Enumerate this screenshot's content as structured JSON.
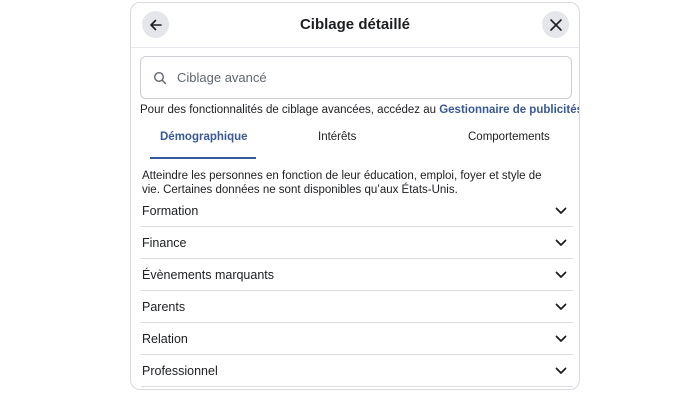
{
  "dialog": {
    "title": "Ciblage détaillé",
    "back_icon": "arrow-left-icon",
    "close_icon": "close-icon"
  },
  "search": {
    "placeholder": "Ciblage avancé",
    "value": "",
    "icon": "search-icon"
  },
  "hint": {
    "text": "Pour des fonctionnalités de ciblage avancées, accédez au ",
    "link": "Gestionnaire de publicités",
    "suffix": "."
  },
  "tabs": [
    {
      "label": "Démographique",
      "active": true
    },
    {
      "label": "Intérêts",
      "active": false
    },
    {
      "label": "Comportements",
      "active": false
    }
  ],
  "description": "Atteindre les personnes en fonction de leur éducation, emploi, foyer et style de vie. Certaines données ne sont disponibles qu’aux États-Unis.",
  "sections": [
    {
      "label": "Formation"
    },
    {
      "label": "Finance"
    },
    {
      "label": "Évènements marquants"
    },
    {
      "label": "Parents"
    },
    {
      "label": "Relation"
    },
    {
      "label": "Professionnel"
    }
  ],
  "colors": {
    "accent": "#385898",
    "button_bg": "#e4e6eb",
    "border": "#dadde1"
  }
}
